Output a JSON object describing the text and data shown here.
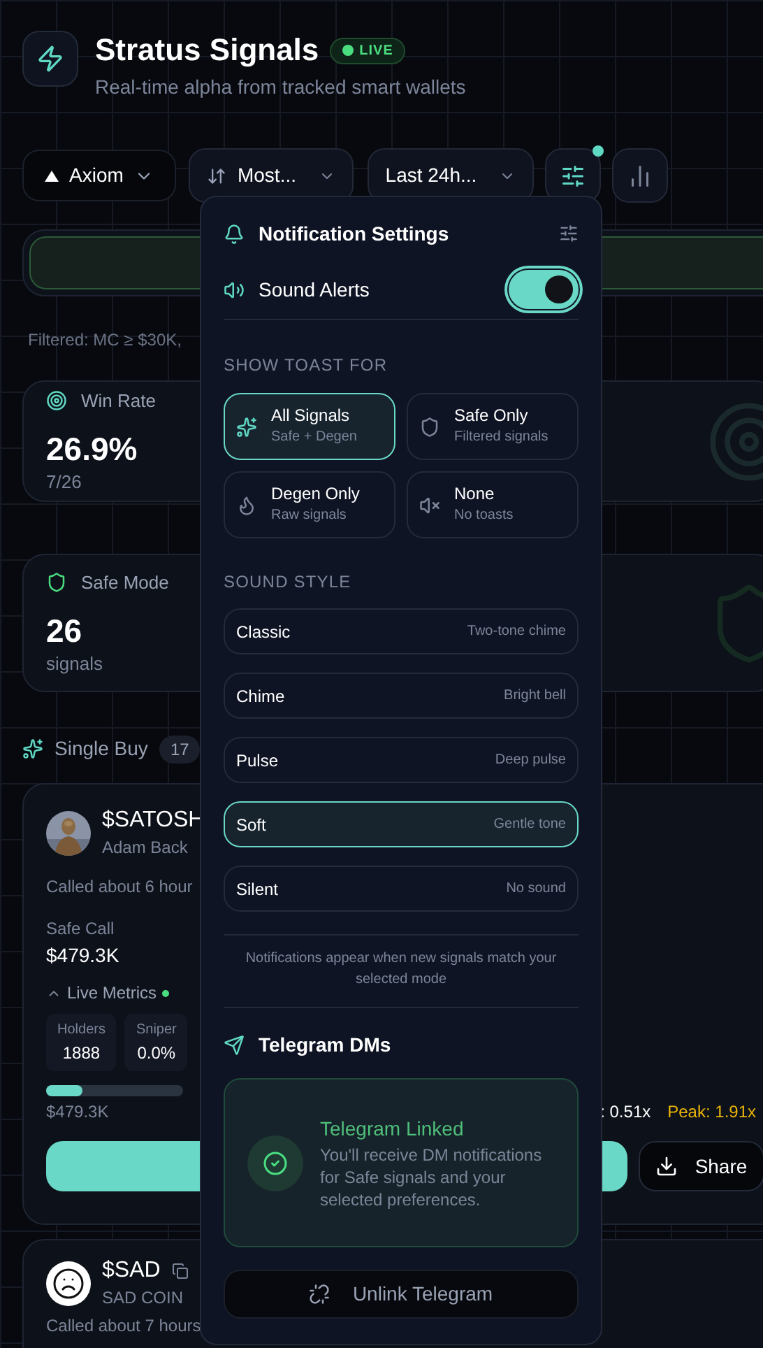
{
  "header": {
    "title": "Stratus Signals",
    "badge": "LIVE",
    "subtitle": "Real-time alpha from tracked smart wallets"
  },
  "toolbar": {
    "platform": "Axiom",
    "sort": "Most...",
    "range": "Last 24h...",
    "filters_active": true
  },
  "filter_note": "Filtered: MC ≥ $30K,",
  "stats": [
    {
      "label": "Win Rate",
      "value": "26.9%",
      "sub": "7/26"
    },
    {
      "label": "Safe Mode",
      "value": "26",
      "sub": "signals"
    }
  ],
  "section": {
    "title": "Single Buy",
    "count": "17"
  },
  "tokens": [
    {
      "symbol": "$SATOSH",
      "name": "Adam Back",
      "called": "Called about 6 hour",
      "call_label": "Safe Call",
      "call_value": "$479.3K",
      "metrics_title": "Live Metrics",
      "metrics": [
        {
          "label": "Holders",
          "value": "1888"
        },
        {
          "label": "Sniper",
          "value": "0.0%"
        }
      ],
      "level": 0.27,
      "mc": "$479.3K",
      "low": ": 0.51x",
      "peak": "Peak: 1.91x",
      "share": "Share"
    },
    {
      "symbol": "$SAD",
      "name": "SAD COIN",
      "called": "Called about 7 hours"
    }
  ],
  "popover": {
    "title": "Notification Settings",
    "sound_alerts": {
      "label": "Sound Alerts",
      "on": true
    },
    "toast_heading": "SHOW TOAST FOR",
    "toast_options": [
      {
        "title": "All Signals",
        "sub": "Safe + Degen",
        "selected": true
      },
      {
        "title": "Safe Only",
        "sub": "Filtered signals",
        "selected": false
      },
      {
        "title": "Degen Only",
        "sub": "Raw signals",
        "selected": false
      },
      {
        "title": "None",
        "sub": "No toasts",
        "selected": false
      }
    ],
    "sound_heading": "SOUND STYLE",
    "sound_styles": [
      {
        "name": "Classic",
        "desc": "Two-tone chime",
        "selected": false
      },
      {
        "name": "Chime",
        "desc": "Bright bell",
        "selected": false
      },
      {
        "name": "Pulse",
        "desc": "Deep pulse",
        "selected": false
      },
      {
        "name": "Soft",
        "desc": "Gentle tone",
        "selected": true
      },
      {
        "name": "Silent",
        "desc": "No sound",
        "selected": false
      }
    ],
    "note": "Notifications appear when new signals match your selected mode",
    "telegram": {
      "title": "Telegram DMs",
      "status": "Telegram Linked",
      "message": "You'll receive DM notifications for Safe signals and your selected preferences.",
      "unlink": "Unlink Telegram"
    }
  }
}
